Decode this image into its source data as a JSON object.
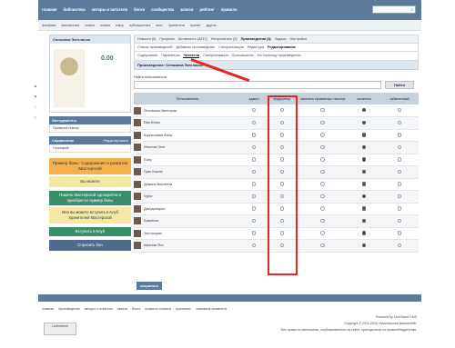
{
  "topnav": [
    "главная",
    "библиотека",
    "авторы и читатели",
    "блоги",
    "сообщества",
    "записи",
    "рейтинг",
    "правила"
  ],
  "subnav": [
    "фанфики",
    "фантастика",
    "сказки",
    "поэзия",
    "юмор",
    "публицистика",
    "эпос",
    "Хранители",
    "прочее",
    "другое..."
  ],
  "sidebar": {
    "profile_title": "Снежинка Экгелисон",
    "balance": "0.00",
    "instruments_title": "Инструменты",
    "instrument_item": "Проверка ссылок",
    "reference_title": "Справочник",
    "reference_edit": "Редактировать",
    "reference_item": "Глоссарий",
    "promo1": "Пример бапы: Содержание и развитие Мастерской",
    "promo2": "Вы можете",
    "promo3": "Помочь Мастерской однократно и приобрести пример бапы",
    "promo4": "Или вы можете вступить в Клуб Хранителей Мастерской",
    "promo5": "Вступить в Клуб",
    "promo6": "Спросить бон"
  },
  "tabs1": [
    "Новости (5)",
    "Профиль",
    "Активность (3237)",
    "Непрочитано (3)",
    "Произведения (3)",
    "Задачи",
    "Настройки"
  ],
  "tabs1_active": "Произведения (3)",
  "tabs2": [
    "Список произведений",
    "Добавить произведение",
    "Синхронизация",
    "Редактура",
    "Редактирование"
  ],
  "tabs2_active": "Редактирование",
  "tabs3": [
    "Содержание",
    "Параметры",
    "Читатели",
    "Синхронизация",
    "Приглашения",
    "На страницу произведения"
  ],
  "tabs3_active": "Читатели",
  "section_title": "Произведение: Снежинка Экгелисон",
  "find_label": "Найти пользователя:",
  "find_button": "Найти",
  "table_headers": [
    "Пользователь",
    "админ",
    "модератор",
    "читатель приватных текстов",
    "читатель",
    "забаненный"
  ],
  "rows": [
    {
      "name": "Лесовская Виктория",
      "role": 4
    },
    {
      "name": "Ева Юлия",
      "role": 4
    },
    {
      "name": "Корнеловна Анна",
      "role": 4
    },
    {
      "name": "Игнатов Олег",
      "role": 4
    },
    {
      "name": "Ruby",
      "role": 4
    },
    {
      "name": "Грин Кошле",
      "role": 4
    },
    {
      "name": "Дёмина Виолетта",
      "role": 4
    },
    {
      "name": "Vglov",
      "role": 4
    },
    {
      "name": "Декоданарол",
      "role": 4
    },
    {
      "name": "Базиечек",
      "role": 4
    },
    {
      "name": "Тептокорин",
      "role": 4
    },
    {
      "name": "Капитан Фог",
      "role": 4
    }
  ],
  "save_button": "сохранить",
  "footer_links": [
    "главная",
    "произведения",
    "авторы и читатели",
    "записи",
    "блоги",
    "правила сервиса",
    "хранитель",
    "значимые комменты"
  ],
  "footer_right": [
    "Powered by LiveStreet CMS",
    "Copyright © 2011-2016 «Мастерская писателей»",
    "Все права на материалы, опубликованные на сайте, принадлежат их правообладателям."
  ],
  "counter": "LiveInternet"
}
